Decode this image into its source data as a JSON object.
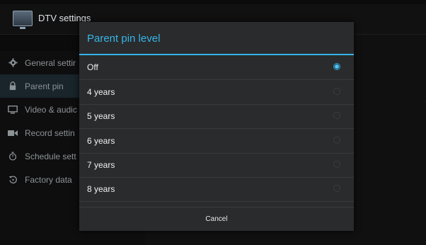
{
  "app": {
    "title": "DTV settings"
  },
  "sidebar": {
    "items": [
      {
        "label": "General settir",
        "icon": "gear-icon",
        "selected": false
      },
      {
        "label": "Parent pin",
        "icon": "lock-icon",
        "selected": true
      },
      {
        "label": "Video & audic",
        "icon": "monitor-icon",
        "selected": false
      },
      {
        "label": "Record settin",
        "icon": "record-camera-icon",
        "selected": false
      },
      {
        "label": "Schedule sett",
        "icon": "timer-icon",
        "selected": false
      },
      {
        "label": "Factory data",
        "icon": "restore-icon",
        "selected": false
      }
    ]
  },
  "dialog": {
    "title": "Parent pin level",
    "options": [
      {
        "label": "Off",
        "checked": true
      },
      {
        "label": "4 years",
        "checked": false
      },
      {
        "label": "5 years",
        "checked": false
      },
      {
        "label": "6 years",
        "checked": false
      },
      {
        "label": "7 years",
        "checked": false
      },
      {
        "label": "8 years",
        "checked": false
      }
    ],
    "cancel_label": "Cancel"
  },
  "colors": {
    "accent": "#33b5e5",
    "dialog_bg": "#2a2b2d",
    "screen_bg": "#0b0b0b"
  }
}
